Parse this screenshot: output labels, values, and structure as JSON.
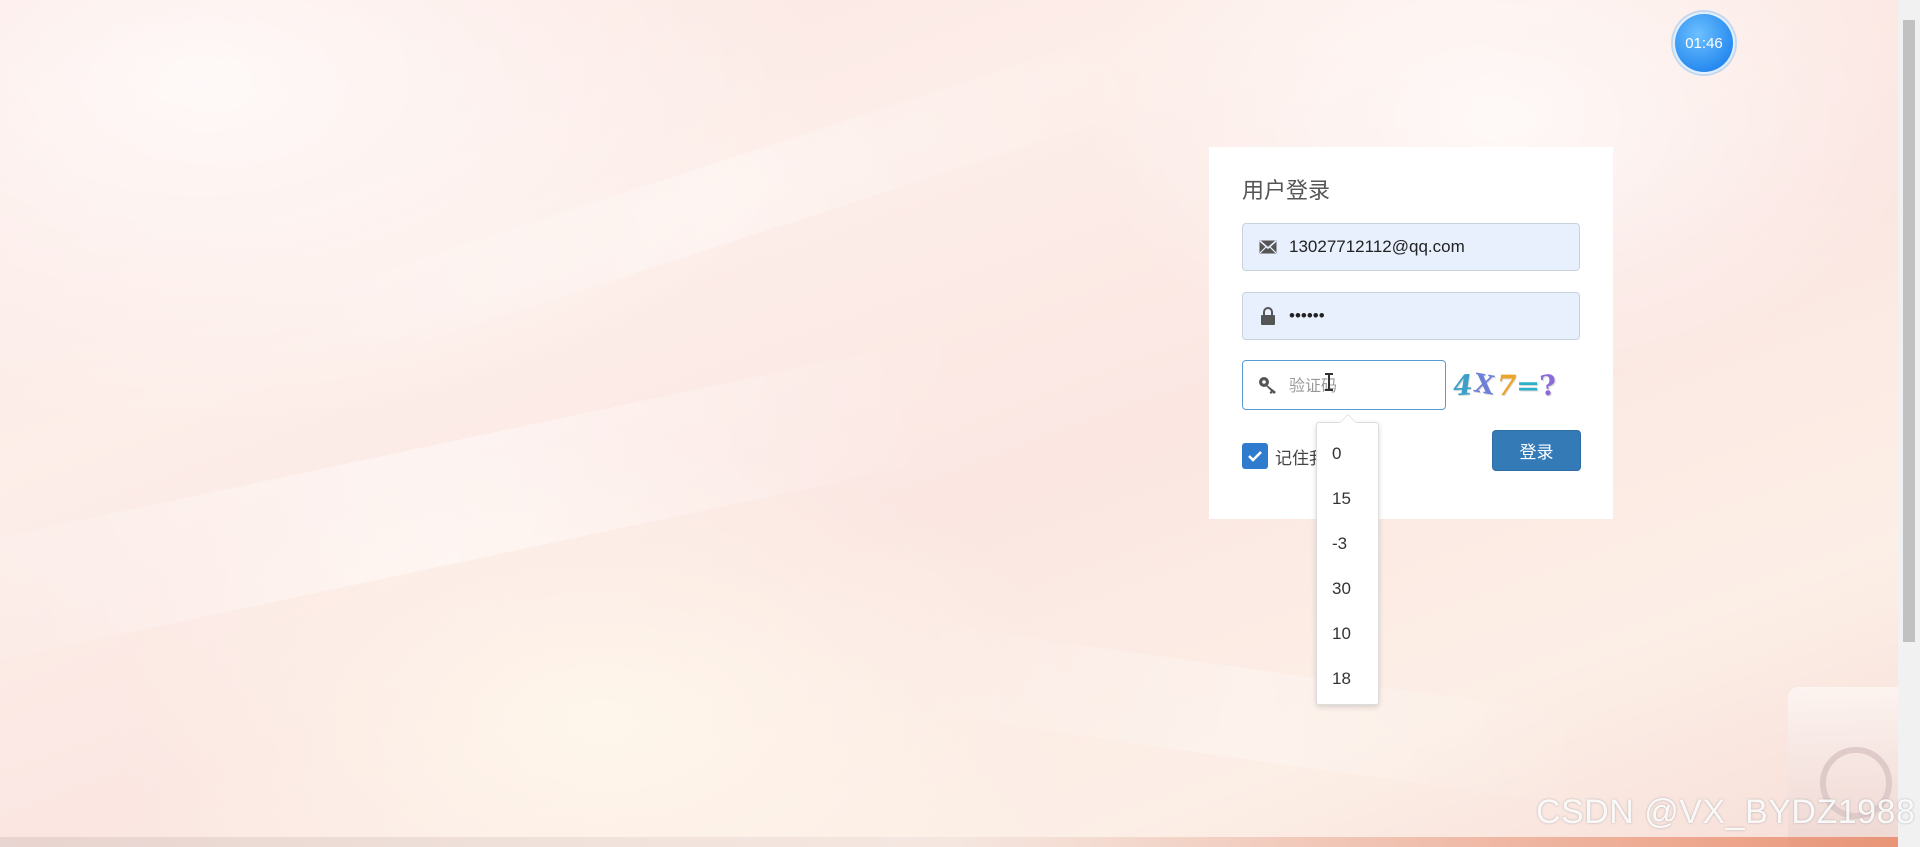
{
  "timer": {
    "text": "01:46"
  },
  "login": {
    "title": "用户登录",
    "username_value": "13027712112@qq.com",
    "password_value": "••••••",
    "captcha_placeholder": "验证码",
    "captcha_image_text": [
      "4",
      "X",
      "7",
      "=",
      "?"
    ],
    "remember_label": "记住我",
    "remember_checked": true,
    "submit_label": "登录"
  },
  "captcha_dropdown": {
    "options": [
      "0",
      "15",
      "-3",
      "30",
      "10",
      "18"
    ]
  },
  "watermark": "CSDN @VX_BYDZ1988",
  "colors": {
    "primary_button": "#337ab7",
    "checkbox": "#2f7ccf",
    "autofill_bg": "#e8f0fe",
    "timer": "#2a8cf0"
  },
  "icons": {
    "username": "envelope-icon",
    "password": "lock-icon",
    "captcha": "key-icon",
    "checkbox": "checkmark-icon"
  }
}
